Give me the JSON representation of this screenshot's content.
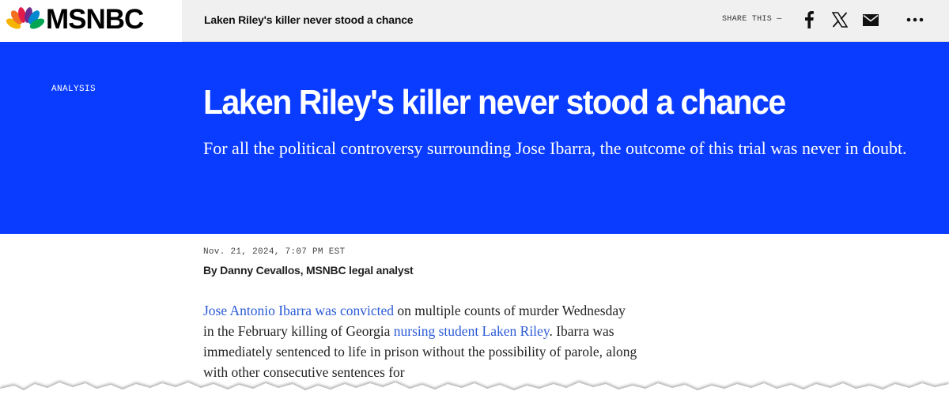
{
  "header": {
    "brand": "MSNBC",
    "title": "Laken Riley's killer never stood a chance",
    "share_label": "SHARE THIS —",
    "icons": [
      "facebook-icon",
      "x-icon",
      "mail-icon",
      "more-icon"
    ]
  },
  "hero": {
    "eyebrow": "ANALYSIS",
    "headline": "Laken Riley's killer never stood a chance",
    "dek": "For all the political controversy surrounding Jose Ibarra, the outcome of this trial was never in doubt."
  },
  "meta": {
    "date": "Nov. 21, 2024, 7:07 PM EST",
    "byline": "By Danny Cevallos, MSNBC legal analyst"
  },
  "body": {
    "link1": "Jose Antonio Ibarra was convicted",
    "text1": " on multiple counts of murder Wednesday in the February killing of Georgia ",
    "link2": "nursing student Laken Riley",
    "text2": ". Ibarra was immediately sentenced to life in prison without the possibility of parole, along with other consecutive sentences for"
  },
  "colors": {
    "hero_blue": "#0a3cff",
    "link_blue": "#2a5ad6",
    "header_bg": "#f0f0f0"
  }
}
